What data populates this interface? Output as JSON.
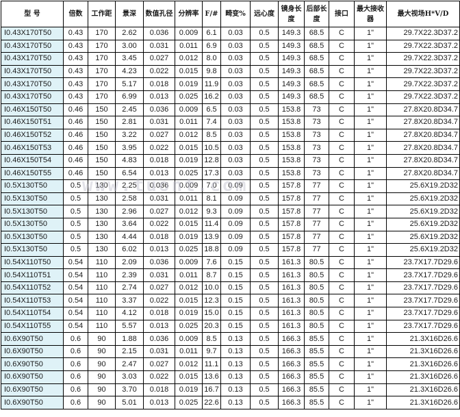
{
  "table": {
    "headers": [
      "型 号",
      "倍数",
      "工作距",
      "景深",
      "数值孔径",
      "分辨率",
      "F/#",
      "畸变%",
      "远心度",
      "镜身长度",
      "后部长度",
      "接口",
      "最大接收器",
      "最大视场H*V/D"
    ],
    "rows": [
      [
        "I0.43X170T50",
        "0.43",
        "170",
        "2.62",
        "0.036",
        "0.009",
        "6.1",
        "0.03",
        "0.5",
        "149.3",
        "68.5",
        "C",
        "1\"",
        "29.7X22.3D37.2"
      ],
      [
        "I0.43X170T50",
        "0.43",
        "170",
        "3.00",
        "0.031",
        "0.011",
        "6.9",
        "0.03",
        "0.5",
        "149.3",
        "68.5",
        "C",
        "1\"",
        "29.7X22.3D37.2"
      ],
      [
        "I0.43X170T50",
        "0.43",
        "170",
        "3.45",
        "0.027",
        "0.012",
        "8.0",
        "0.03",
        "0.5",
        "149.3",
        "68.5",
        "C",
        "1\"",
        "29.7X22.3D37.2"
      ],
      [
        "I0.43X170T50",
        "0.43",
        "170",
        "4.23",
        "0.022",
        "0.015",
        "9.8",
        "0.03",
        "0.5",
        "149.3",
        "68.5",
        "C",
        "1\"",
        "29.7X22.3D37.2"
      ],
      [
        "I0.43X170T50",
        "0.43",
        "170",
        "5.17",
        "0.018",
        "0.019",
        "11.9",
        "0.03",
        "0.5",
        "149.3",
        "68.5",
        "C",
        "1\"",
        "29.7X22.3D37.2"
      ],
      [
        "I0.43X170T50",
        "0.43",
        "170",
        "6.99",
        "0.013",
        "0.025",
        "16.2",
        "0.03",
        "0.5",
        "149.3",
        "68.5",
        "C",
        "1\"",
        "29.7X22.3D37.2"
      ],
      [
        "I0.46X150T50",
        "0.46",
        "150",
        "2.45",
        "0.036",
        "0.009",
        "6.5",
        "0.03",
        "0.5",
        "153.8",
        "73",
        "C",
        "1\"",
        "27.8X20.8D34.7"
      ],
      [
        "I0.46X150T51",
        "0.46",
        "150",
        "2.81",
        "0.031",
        "0.011",
        "7.4",
        "0.03",
        "0.5",
        "153.8",
        "73",
        "C",
        "1\"",
        "27.8X20.8D34.7"
      ],
      [
        "I0.46X150T52",
        "0.46",
        "150",
        "3.22",
        "0.027",
        "0.012",
        "8.5",
        "0.03",
        "0.5",
        "153.8",
        "73",
        "C",
        "1\"",
        "27.8X20.8D34.7"
      ],
      [
        "I0.46X150T53",
        "0.46",
        "150",
        "3.95",
        "0.022",
        "0.015",
        "10.5",
        "0.03",
        "0.5",
        "153.8",
        "73",
        "C",
        "1\"",
        "27.8X20.8D34.7"
      ],
      [
        "I0.46X150T54",
        "0.46",
        "150",
        "4.83",
        "0.018",
        "0.019",
        "12.8",
        "0.03",
        "0.5",
        "153.8",
        "73",
        "C",
        "1\"",
        "27.8X20.8D34.7"
      ],
      [
        "I0.46X150T55",
        "0.46",
        "150",
        "6.54",
        "0.013",
        "0.025",
        "17.3",
        "0.03",
        "0.5",
        "153.8",
        "73",
        "C",
        "1\"",
        "27.8X20.8D34.7"
      ],
      [
        "I0.5X130T50",
        "0.5",
        "130",
        "2.25",
        "0.036",
        "0.009",
        "7.0",
        "0.09",
        "0.5",
        "157.8",
        "77",
        "C",
        "1\"",
        "25.6X19.2D32"
      ],
      [
        "I0.5X130T50",
        "0.5",
        "130",
        "2.58",
        "0.031",
        "0.011",
        "8.1",
        "0.09",
        "0.5",
        "157.8",
        "77",
        "C",
        "1\"",
        "25.6X19.2D32"
      ],
      [
        "I0.5X130T50",
        "0.5",
        "130",
        "2.96",
        "0.027",
        "0.012",
        "9.3",
        "0.09",
        "0.5",
        "157.8",
        "77",
        "C",
        "1\"",
        "25.6X19.2D32"
      ],
      [
        "I0.5X130T50",
        "0.5",
        "130",
        "3.64",
        "0.022",
        "0.015",
        "11.4",
        "0.09",
        "0.5",
        "157.8",
        "77",
        "C",
        "1\"",
        "25.6X19.2D32"
      ],
      [
        "I0.5X130T50",
        "0.5",
        "130",
        "4.44",
        "0.018",
        "0.019",
        "13.9",
        "0.09",
        "0.5",
        "157.8",
        "77",
        "C",
        "1\"",
        "25.6X19.2D32"
      ],
      [
        "I0.5X130T50",
        "0.5",
        "130",
        "6.02",
        "0.013",
        "0.025",
        "18.8",
        "0.09",
        "0.5",
        "157.8",
        "77",
        "C",
        "1\"",
        "25.6X19.2D32"
      ],
      [
        "I0.54X110T50",
        "0.54",
        "110",
        "2.09",
        "0.036",
        "0.009",
        "7.6",
        "0.15",
        "0.5",
        "161.3",
        "80.5",
        "C",
        "1\"",
        "23.7X17.7D29.6"
      ],
      [
        "I0.54X110T51",
        "0.54",
        "110",
        "2.39",
        "0.031",
        "0.011",
        "8.7",
        "0.15",
        "0.5",
        "161.3",
        "80.5",
        "C",
        "1\"",
        "23.7X17.7D29.6"
      ],
      [
        "I0.54X110T52",
        "0.54",
        "110",
        "2.74",
        "0.027",
        "0.012",
        "10.0",
        "0.15",
        "0.5",
        "161.3",
        "80.5",
        "C",
        "1\"",
        "23.7X17.7D29.6"
      ],
      [
        "I0.54X110T53",
        "0.54",
        "110",
        "3.37",
        "0.022",
        "0.015",
        "12.3",
        "0.15",
        "0.5",
        "161.3",
        "80.5",
        "C",
        "1\"",
        "23.7X17.7D29.6"
      ],
      [
        "I0.54X110T54",
        "0.54",
        "110",
        "4.12",
        "0.018",
        "0.019",
        "15.0",
        "0.15",
        "0.5",
        "161.3",
        "80.5",
        "C",
        "1\"",
        "23.7X17.7D29.6"
      ],
      [
        "I0.54X110T55",
        "0.54",
        "110",
        "5.57",
        "0.013",
        "0.025",
        "20.3",
        "0.15",
        "0.5",
        "161.3",
        "80.5",
        "C",
        "1\"",
        "23.7X17.7D29.6"
      ],
      [
        "I0.6X90T50",
        "0.6",
        "90",
        "1.88",
        "0.036",
        "0.009",
        "8.5",
        "0.13",
        "0.5",
        "166.3",
        "85.5",
        "C",
        "1\"",
        "21.3X16D26.6"
      ],
      [
        "I0.6X90T50",
        "0.6",
        "90",
        "2.15",
        "0.031",
        "0.011",
        "9.7",
        "0.13",
        "0.5",
        "166.3",
        "85.5",
        "C",
        "1\"",
        "21.3X16D26.6"
      ],
      [
        "I0.6X90T50",
        "0.6",
        "90",
        "2.47",
        "0.027",
        "0.012",
        "11.1",
        "0.13",
        "0.5",
        "166.3",
        "85.5",
        "C",
        "1\"",
        "21.3X16D26.6"
      ],
      [
        "I0.6X90T50",
        "0.6",
        "90",
        "3.03",
        "0.022",
        "0.015",
        "13.6",
        "0.13",
        "0.5",
        "166.3",
        "85.5",
        "C",
        "1\"",
        "21.3X16D26.6"
      ],
      [
        "I0.6X90T50",
        "0.6",
        "90",
        "3.70",
        "0.018",
        "0.019",
        "16.7",
        "0.13",
        "0.5",
        "166.3",
        "85.5",
        "C",
        "1\"",
        "21.3X16D26.6"
      ],
      [
        "I0.6X90T50",
        "0.6",
        "90",
        "5.01",
        "0.013",
        "0.025",
        "22.6",
        "0.13",
        "0.5",
        "166.3",
        "85.5",
        "C",
        "1\"",
        "21.3X16D26.6"
      ]
    ]
  },
  "watermark": "www.tuont.com",
  "colors": {
    "model_cell_bg": "#dff2f7",
    "border": "#000000",
    "text": "#1a1a1a"
  }
}
